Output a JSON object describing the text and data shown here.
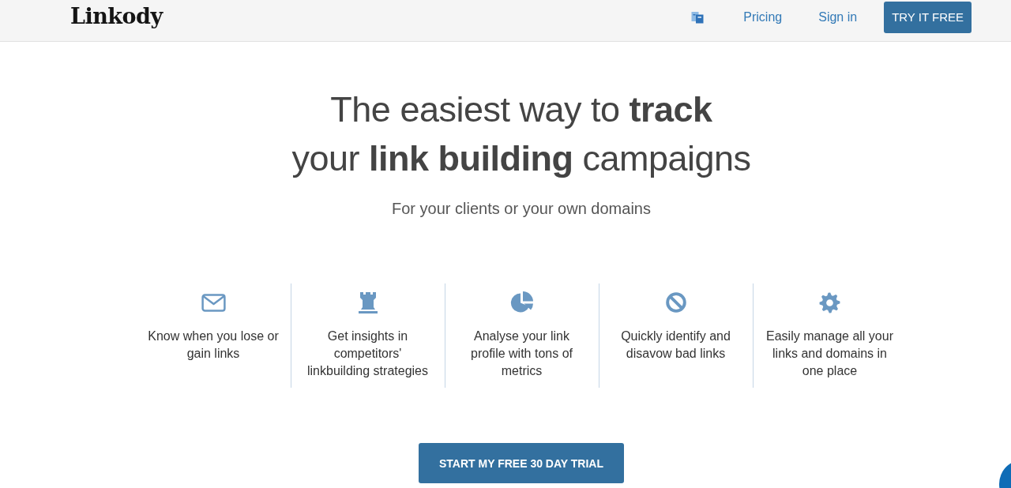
{
  "header": {
    "logo": "Linkody",
    "nav_links": [
      "Pricing",
      "Sign in"
    ],
    "cta_button": "TRY IT FREE"
  },
  "hero": {
    "headline": "The easiest way to **track**\nyour **link building** campaigns",
    "subtitle": "For your clients or your own domains"
  },
  "features": [
    {
      "kind": "alerts",
      "text": "Know when you lose or gain links"
    },
    {
      "kind": "competitors",
      "text": "Get insights in competitors' linkbuilding strategies"
    },
    {
      "kind": "metrics",
      "text": "Analyse your link profile with tons of metrics"
    },
    {
      "kind": "disavow",
      "text": "Quickly identify and disavow bad links"
    },
    {
      "kind": "manage",
      "text": "Easily manage all your links and domains in one place"
    }
  ],
  "cta": {
    "label": "START MY FREE 30 DAY TRIAL"
  }
}
